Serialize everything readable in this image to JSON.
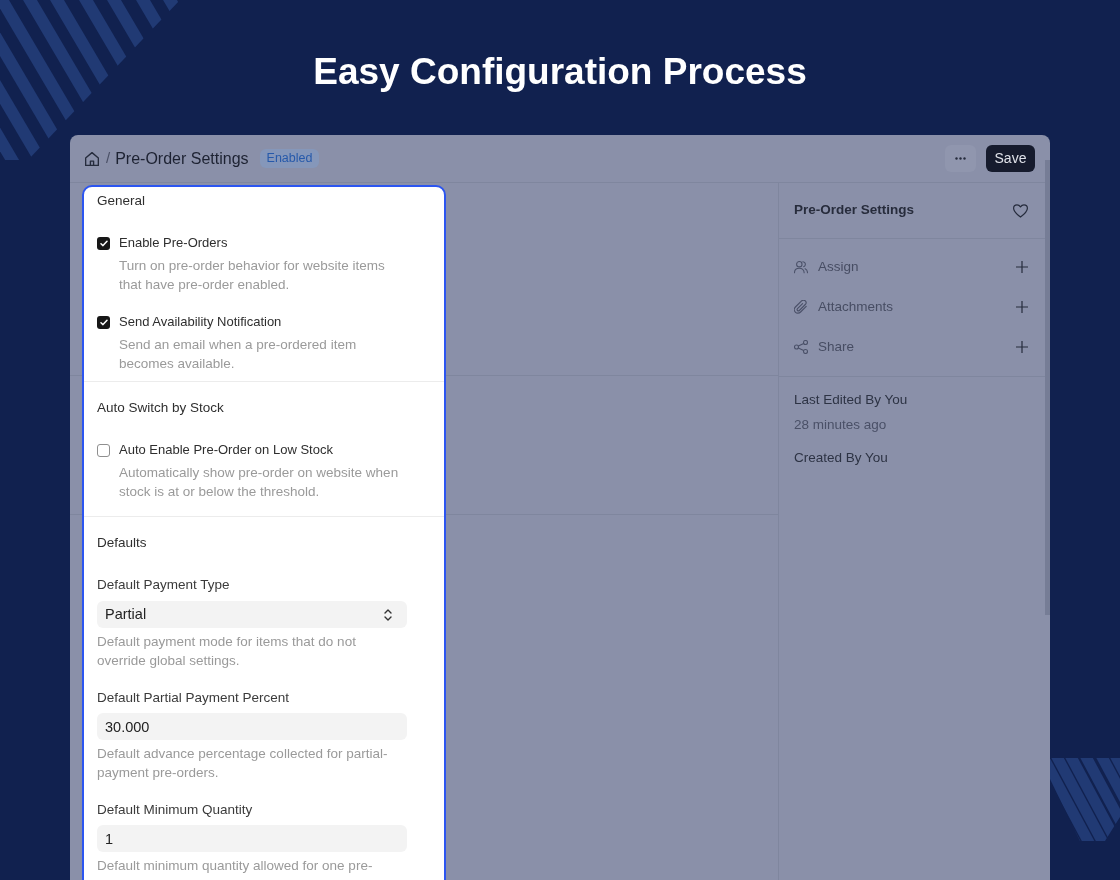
{
  "headline": "Easy Configuration Process",
  "header": {
    "separator": "/",
    "title": "Pre-Order Settings",
    "badge": "Enabled",
    "save_button": "Save"
  },
  "form": {
    "sections": [
      {
        "title": "General",
        "fields": [
          {
            "kind": "checkbox",
            "label": "Enable Pre-Orders",
            "checked": true,
            "description": "Turn on pre-order behavior for website items that have pre-order enabled."
          },
          {
            "kind": "checkbox",
            "label": "Send Availability Notification",
            "checked": true,
            "description": "Send an email when a pre-ordered item becomes available."
          }
        ]
      },
      {
        "title": "Auto Switch by Stock",
        "fields": [
          {
            "kind": "checkbox",
            "label": "Auto Enable Pre-Order on Low Stock",
            "checked": false,
            "description": "Automatically show pre-order on website when stock is at or below the threshold."
          }
        ]
      },
      {
        "title": "Defaults",
        "fields": [
          {
            "kind": "select",
            "label": "Default Payment Type",
            "value": "Partial",
            "description": "Default payment mode for items that do not override global settings."
          },
          {
            "kind": "input",
            "label": "Default Partial Payment Percent",
            "value": "30.000",
            "description": "Default advance percentage collected for partial-payment pre-orders."
          },
          {
            "kind": "input",
            "label": "Default Minimum Quantity",
            "value": "1",
            "description": "Default minimum quantity allowed for one pre-"
          }
        ]
      }
    ]
  },
  "sidebar": {
    "title": "Pre-Order Settings",
    "actions": [
      {
        "label": "Assign"
      },
      {
        "label": "Attachments"
      },
      {
        "label": "Share"
      }
    ],
    "activity": [
      {
        "text": "Last Edited By You",
        "time": "28 minutes ago"
      },
      {
        "text": "Created By You"
      }
    ]
  }
}
